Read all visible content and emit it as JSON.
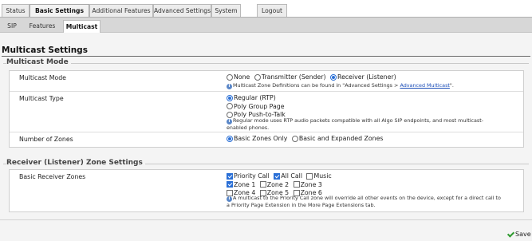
{
  "top_tabs": [
    "Status",
    "Basic Settings",
    "Additional Features",
    "Advanced Settings",
    "System",
    "Logout"
  ],
  "active_top_tab": "Basic Settings",
  "sub_tabs": [
    "SIP",
    "Features",
    "Multicast"
  ],
  "active_sub_tab": "Multicast",
  "page_title": "Multicast Settings",
  "sections": {
    "multicast_mode": {
      "legend": "Multicast Mode",
      "mode": {
        "label": "Multicast Mode",
        "options": [
          "None",
          "Transmitter (Sender)",
          "Receiver (Listener)"
        ],
        "selected": "Receiver (Listener)",
        "info_prefix": "Multicast Zone Definitions can be found in \"Advanced Settings > ",
        "info_link": "Advanced Multicast",
        "info_suffix": "\"."
      },
      "type": {
        "label": "Multicast Type",
        "options": [
          "Regular (RTP)",
          "Poly Group Page",
          "Poly Push-to-Talk"
        ],
        "selected": "Regular (RTP)",
        "info_line1": "Regular mode uses RTP audio packets compatible with all Algo SIP endpoints, and most multicast-",
        "info_line2": "enabled phones."
      },
      "zones": {
        "label": "Number of Zones",
        "options": [
          "Basic Zones Only",
          "Basic and Expanded Zones"
        ],
        "selected": "Basic Zones Only"
      }
    },
    "receiver_zones": {
      "legend": "Receiver (Listener) Zone Settings",
      "basic": {
        "label": "Basic Receiver Zones",
        "row1": [
          "Priority Call",
          "All Call",
          "Music"
        ],
        "row2": [
          "Zone 1",
          "Zone 2",
          "Zone 3"
        ],
        "row3": [
          "Zone 4",
          "Zone 5",
          "Zone 6"
        ],
        "checked": [
          "Priority Call",
          "All Call",
          "Zone 1"
        ],
        "info_line1": "A multicast to the Priority Call zone will override all other events on the device, except for a direct call to",
        "info_line2": "a Priority Page Extension in the More Page Extensions tab."
      }
    }
  },
  "save_label": "Save",
  "colors": {
    "accent": "#2a6fd6",
    "link": "#1d4fb8",
    "save_check": "#2f9a2f"
  }
}
